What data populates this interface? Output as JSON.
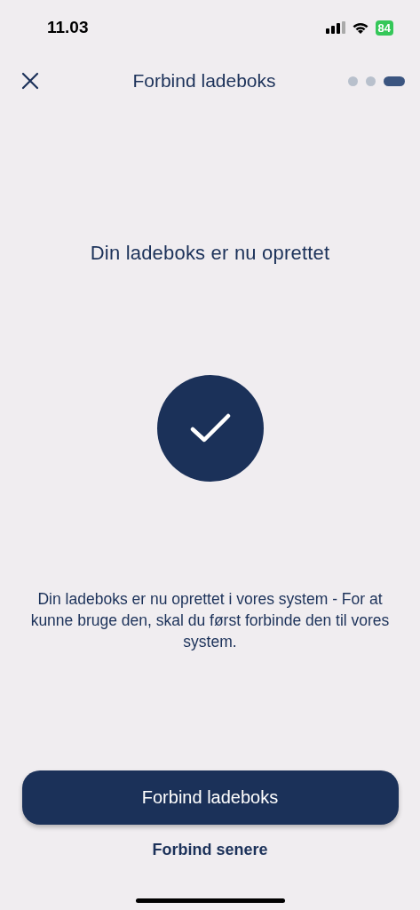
{
  "status_bar": {
    "time": "11.03",
    "battery": "84"
  },
  "header": {
    "title": "Forbind ladeboks",
    "steps": [
      {
        "selected": false
      },
      {
        "selected": false
      },
      {
        "selected": true
      }
    ]
  },
  "heading": "Din ladeboks er nu oprettet",
  "description": "Din ladeboks er nu oprettet i vores system - For at kunne bruge den, skal du først forbinde den til vores system.",
  "primary_button": "Forbind ladeboks",
  "secondary_link": "Forbind senere"
}
